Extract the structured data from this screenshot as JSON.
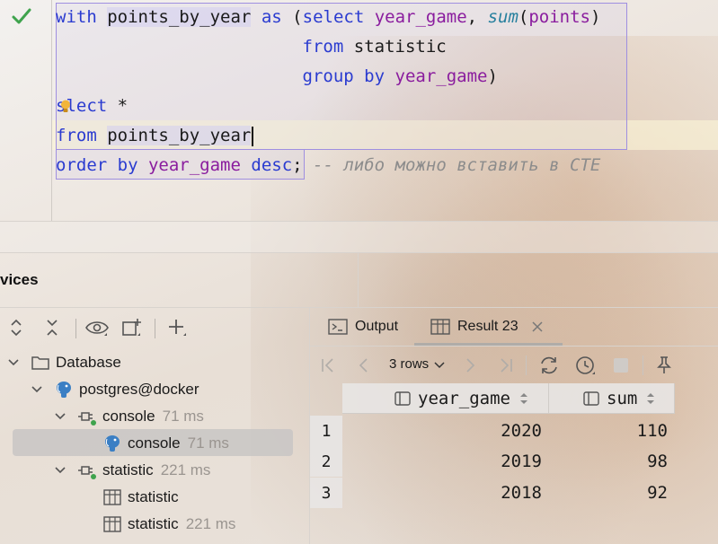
{
  "editor": {
    "lines": [
      {
        "t1": "with",
        "t2": "points_by_year",
        "t3": "as",
        "t4": "(",
        "t5": "select",
        "t6": "year_game",
        "t7": ", ",
        "t8": "sum",
        "t9": "(",
        "t10": "points",
        "t11": ")"
      },
      {
        "kw": "from",
        "rest": "statistic"
      },
      {
        "kw": "group by",
        "id": "year_game",
        "end": ")"
      },
      {
        "a": "s",
        "b": "lect *",
        "pre": "se"
      },
      {
        "kw": "from",
        "rest": "points_by_year"
      },
      {
        "kw": "order by",
        "id": "year_game",
        "kw2": "desc",
        "semi": ";",
        "comment": "-- либо можно вставить в CTE"
      }
    ]
  },
  "services": {
    "title": "vices"
  },
  "tree": {
    "database": "Database",
    "postgres": "postgres@docker",
    "console_group": "console",
    "console_group_ms": "71 ms",
    "console_item": "console",
    "console_item_ms": "71 ms",
    "statistic_group": "statistic",
    "statistic_group_ms": "221 ms",
    "statistic_table": "statistic",
    "statistic_item": "statistic",
    "statistic_item_ms": "221 ms"
  },
  "tabs": {
    "output": "Output",
    "result": "Result 23"
  },
  "results": {
    "rows_label": "3 rows",
    "columns": [
      "year_game",
      "sum"
    ],
    "rows": [
      {
        "n": "1",
        "year_game": "2020",
        "sum": "110"
      },
      {
        "n": "2",
        "year_game": "2019",
        "sum": "98"
      },
      {
        "n": "3",
        "year_game": "2018",
        "sum": "92"
      }
    ]
  },
  "colors": {
    "keyword": "#2a3bd0",
    "identifier": "#8a1c9e",
    "function": "#27809e",
    "comment": "#8c8c8c",
    "success": "#3fa34d"
  }
}
